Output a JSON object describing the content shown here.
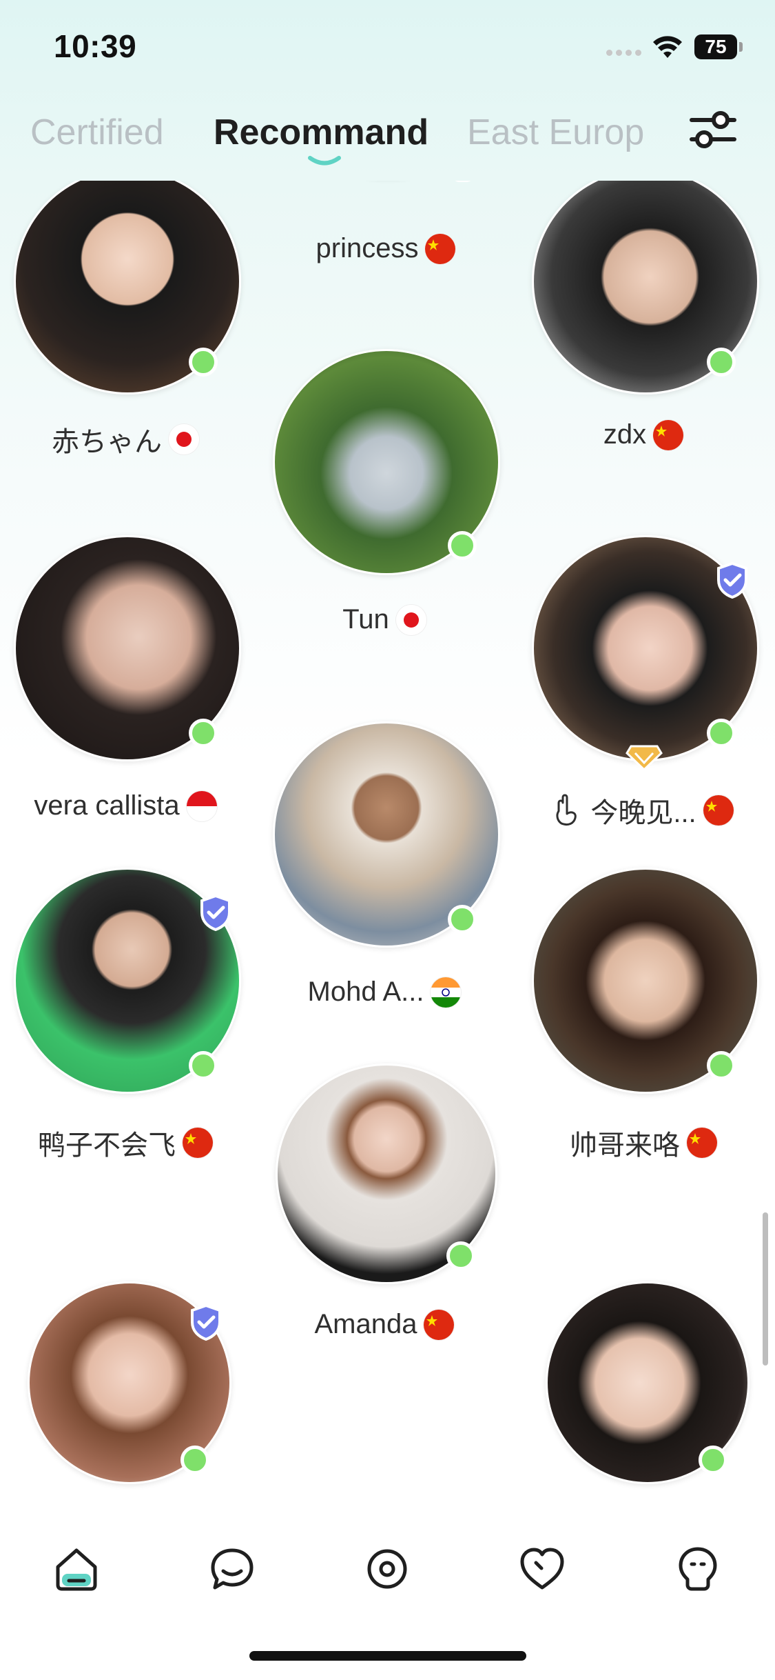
{
  "status_bar": {
    "time": "10:39",
    "battery": "75"
  },
  "tabs": [
    {
      "label": "Certified",
      "active": false
    },
    {
      "label": "Recommand",
      "active": true
    },
    {
      "label": "East Europ",
      "active": false
    }
  ],
  "icons": {
    "filter": "sliders-icon",
    "home": "home-icon",
    "chat": "chat-bubble-icon",
    "discover": "target-icon",
    "likes": "heart-icon",
    "profile": "bulb-face-icon"
  },
  "colors": {
    "accent": "#5fd3c4",
    "online": "#7fe06a",
    "verified": "#6f7bea",
    "vip": "#f2b948"
  },
  "users": [
    {
      "name": "princess",
      "flag": "cn",
      "online": true
    },
    {
      "name": "赤ちゃん",
      "flag": "jp",
      "online": true
    },
    {
      "name": "zdx",
      "flag": "cn",
      "online": true
    },
    {
      "name": "Tun",
      "flag": "jp",
      "online": true
    },
    {
      "name": "vera callista",
      "flag": "id",
      "online": true
    },
    {
      "name": "今晚见...",
      "flag": "cn",
      "online": true,
      "verified": true,
      "vip": true,
      "prefix": "hand-icon"
    },
    {
      "name": "Mohd A...",
      "flag": "in",
      "online": true
    },
    {
      "name": "鸭子不会飞",
      "flag": "cn",
      "online": true,
      "verified": true
    },
    {
      "name": "帅哥来咯",
      "flag": "cn",
      "online": true
    },
    {
      "name": "Amanda",
      "flag": "cn",
      "online": true
    },
    {
      "name": "",
      "flag": "",
      "online": true,
      "verified": true
    },
    {
      "name": "",
      "flag": "",
      "online": true
    }
  ]
}
